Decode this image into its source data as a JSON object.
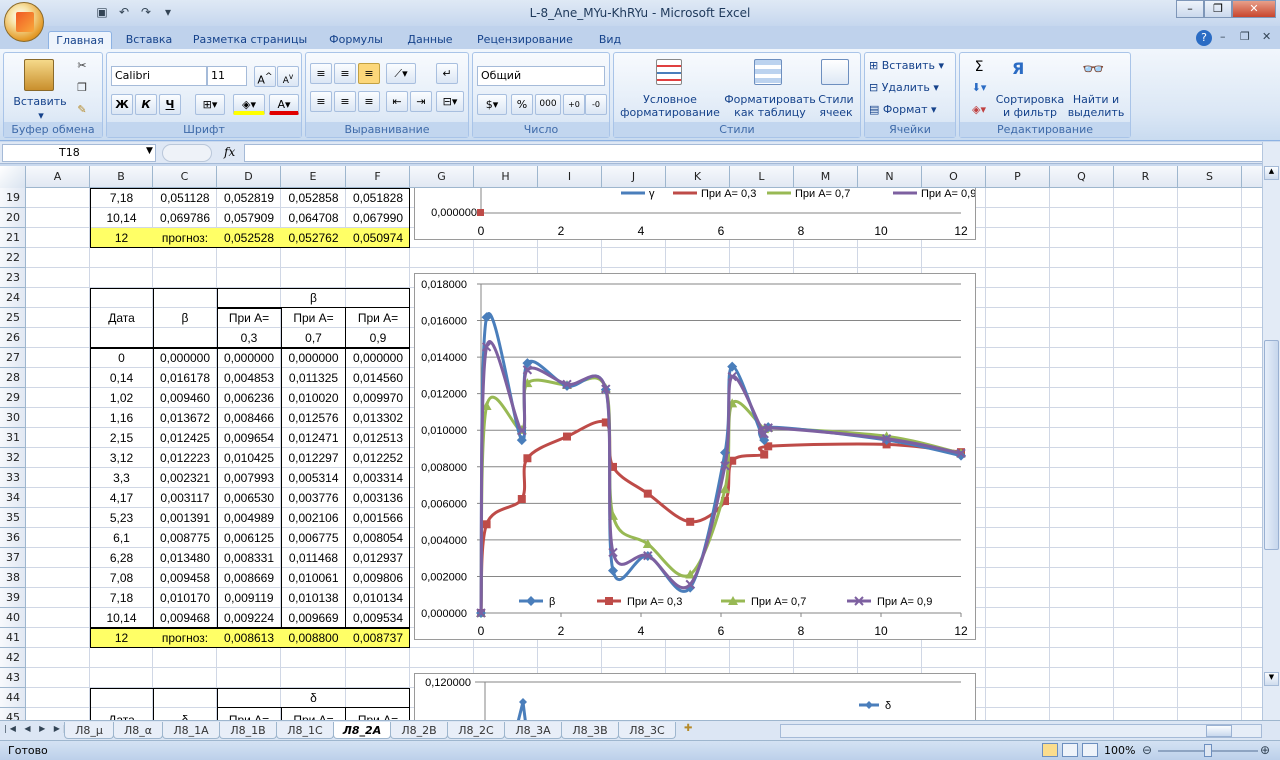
{
  "window": {
    "title": "L-8_Ane_MYu-KhRYu - Microsoft Excel"
  },
  "ribbon": {
    "tabs": [
      "Главная",
      "Вставка",
      "Разметка страницы",
      "Формулы",
      "Данные",
      "Рецензирование",
      "Вид"
    ],
    "paste_label": "Вставить",
    "clipboard_label": "Буфер обмена",
    "font_name": "Calibri",
    "font_size": "11",
    "font_label": "Шрифт",
    "align_label": "Выравнивание",
    "number_format": "Общий",
    "number_label": "Число",
    "cond_format": "Условное форматирование",
    "format_table": "Форматировать как таблицу",
    "cell_styles": "Стили ячеек",
    "styles_label": "Стили",
    "insert_cells": "Вставить",
    "delete_cells": "Удалить",
    "format_cells": "Формат",
    "cells_label": "Ячейки",
    "sort_filter": "Сортировка и фильтр",
    "find_select": "Найти и выделить",
    "editing_label": "Редактирование",
    "bold": "Ж",
    "italic": "К",
    "underline": "Ч",
    "sigma": "Σ"
  },
  "formula_bar": {
    "name_box": "T18",
    "fx": "fx",
    "formula": ""
  },
  "columns": [
    "A",
    "B",
    "C",
    "D",
    "E",
    "F",
    "G",
    "H",
    "I",
    "J",
    "K",
    "L",
    "M",
    "N",
    "O",
    "P",
    "Q",
    "R",
    "S"
  ],
  "rows": [
    "19",
    "20",
    "21",
    "22",
    "23",
    "24",
    "25",
    "26",
    "27",
    "28",
    "29",
    "30",
    "31",
    "32",
    "33",
    "34",
    "35",
    "36",
    "37",
    "38",
    "39",
    "40",
    "41",
    "42",
    "43",
    "44",
    "45"
  ],
  "table_top": [
    [
      "7,18",
      "0,051128",
      "0,052819",
      "0,052858",
      "0,051828"
    ],
    [
      "10,14",
      "0,069786",
      "0,057909",
      "0,064708",
      "0,067990"
    ]
  ],
  "forecast_top": [
    "12",
    "прогноз:",
    "0,052528",
    "0,052762",
    "0,050974"
  ],
  "beta_table": {
    "header_group": "β",
    "date_label": "Дата",
    "beta_label": "β",
    "a_labels": [
      "При А=",
      "При А=",
      "При А="
    ],
    "a_values": [
      "0,3",
      "0,7",
      "0,9"
    ],
    "rows": [
      [
        "0",
        "0,000000",
        "0,000000",
        "0,000000",
        "0,000000"
      ],
      [
        "0,14",
        "0,016178",
        "0,004853",
        "0,011325",
        "0,014560"
      ],
      [
        "1,02",
        "0,009460",
        "0,006236",
        "0,010020",
        "0,009970"
      ],
      [
        "1,16",
        "0,013672",
        "0,008466",
        "0,012576",
        "0,013302"
      ],
      [
        "2,15",
        "0,012425",
        "0,009654",
        "0,012471",
        "0,012513"
      ],
      [
        "3,12",
        "0,012223",
        "0,010425",
        "0,012297",
        "0,012252"
      ],
      [
        "3,3",
        "0,002321",
        "0,007993",
        "0,005314",
        "0,003314"
      ],
      [
        "4,17",
        "0,003117",
        "0,006530",
        "0,003776",
        "0,003136"
      ],
      [
        "5,23",
        "0,001391",
        "0,004989",
        "0,002106",
        "0,001566"
      ],
      [
        "6,1",
        "0,008775",
        "0,006125",
        "0,006775",
        "0,008054"
      ],
      [
        "6,28",
        "0,013480",
        "0,008331",
        "0,011468",
        "0,012937"
      ],
      [
        "7,08",
        "0,009458",
        "0,008669",
        "0,010061",
        "0,009806"
      ],
      [
        "7,18",
        "0,010170",
        "0,009119",
        "0,010138",
        "0,010134"
      ],
      [
        "10,14",
        "0,009468",
        "0,009224",
        "0,009669",
        "0,009534"
      ]
    ],
    "forecast": [
      "12",
      "прогноз:",
      "0,008613",
      "0,008800",
      "0,008737"
    ]
  },
  "delta_table": {
    "header_group": "δ",
    "date_label": "Дата",
    "delta_label": "δ",
    "a_label": "При А="
  },
  "chart_data": [
    {
      "type": "line",
      "x_ticks": [
        "0",
        "2",
        "4",
        "6",
        "8",
        "10",
        "12"
      ],
      "y_ticks": [
        "0,000000"
      ],
      "series": [
        {
          "name": "γ"
        },
        {
          "name": "При А= 0,3"
        },
        {
          "name": "При А= 0,7"
        },
        {
          "name": "При А= 0,9"
        }
      ],
      "colors": [
        "#4a7ebb",
        "#be4b48",
        "#98b954",
        "#7d60a0"
      ]
    },
    {
      "type": "line",
      "title": "",
      "xlim": [
        0,
        12
      ],
      "ylim": [
        0,
        0.018
      ],
      "x": [
        0,
        0.14,
        1.02,
        1.16,
        2.15,
        3.12,
        3.3,
        4.17,
        5.23,
        6.1,
        6.28,
        7.08,
        7.18,
        10.14,
        12
      ],
      "x_ticks": [
        "0",
        "2",
        "4",
        "6",
        "8",
        "10",
        "12"
      ],
      "y_ticks": [
        "0,000000",
        "0,002000",
        "0,004000",
        "0,006000",
        "0,008000",
        "0,010000",
        "0,012000",
        "0,014000",
        "0,016000",
        "0,018000"
      ],
      "series": [
        {
          "name": "β",
          "color": "#4a7ebb",
          "marker": "diamond",
          "values": [
            0,
            0.016178,
            0.00946,
            0.013672,
            0.012425,
            0.012223,
            0.002321,
            0.003117,
            0.001391,
            0.008775,
            0.01348,
            0.009458,
            0.01017,
            0.009468,
            0.008613
          ]
        },
        {
          "name": "При А= 0,3",
          "color": "#be4b48",
          "marker": "square",
          "values": [
            0,
            0.004853,
            0.006236,
            0.008466,
            0.009654,
            0.010425,
            0.007993,
            0.00653,
            0.004989,
            0.006125,
            0.008331,
            0.008669,
            0.009119,
            0.009224,
            0.0088
          ]
        },
        {
          "name": "При А= 0,7",
          "color": "#98b954",
          "marker": "triangle",
          "values": [
            0,
            0.011325,
            0.01002,
            0.012576,
            0.012471,
            0.012297,
            0.005314,
            0.003776,
            0.002106,
            0.006775,
            0.011468,
            0.010061,
            0.010138,
            0.009669,
            0.008737
          ]
        },
        {
          "name": "При А= 0,9",
          "color": "#7d60a0",
          "marker": "x",
          "values": [
            0,
            0.01456,
            0.00997,
            0.013302,
            0.012513,
            0.012252,
            0.003314,
            0.003136,
            0.001566,
            0.008054,
            0.012937,
            0.009806,
            0.010134,
            0.009534,
            0.008737
          ]
        }
      ],
      "legend": "bottom"
    },
    {
      "type": "line",
      "y_ticks": [
        "0,120000"
      ],
      "series": [
        {
          "name": "δ"
        }
      ],
      "legend": "right"
    }
  ],
  "sheets": [
    "Л8_μ",
    "Л8_α",
    "Л8_1А",
    "Л8_1В",
    "Л8_1С",
    "Л8_2А",
    "Л8_2В",
    "Л8_2С",
    "Л8_3А",
    "Л8_3В",
    "Л8_3С"
  ],
  "active_sheet": "Л8_2А",
  "status": {
    "ready": "Готово",
    "zoom": "100%"
  }
}
